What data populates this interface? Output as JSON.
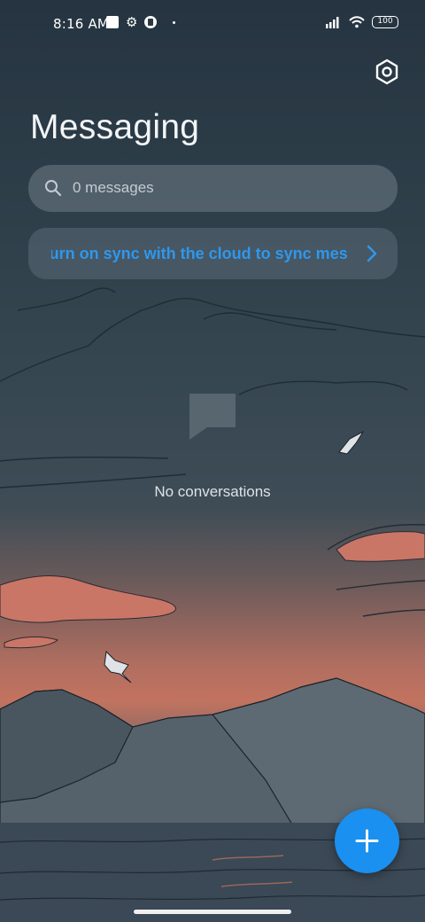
{
  "status_bar": {
    "time": "8:16 AM",
    "battery": "100"
  },
  "header": {
    "title": "Messaging"
  },
  "search": {
    "placeholder": "0 messages"
  },
  "sync_banner": {
    "text": "Turn on sync with the cloud to sync messages"
  },
  "empty_state": {
    "text": "No conversations"
  },
  "colors": {
    "accent": "#1a90f0",
    "sync_text": "#2e98ee"
  },
  "icons": {
    "settings": "settings-icon",
    "search": "search-icon",
    "chevron": "chevron-right-icon",
    "empty": "message-bubble-icon",
    "compose": "plus-icon"
  }
}
